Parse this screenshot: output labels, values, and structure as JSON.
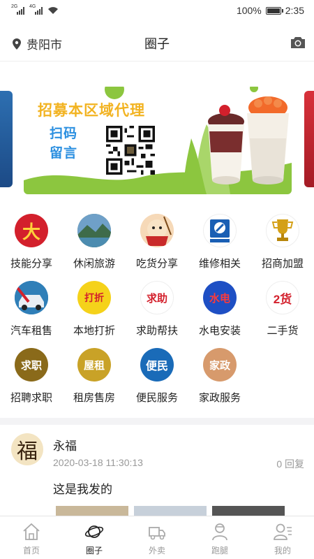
{
  "status_bar": {
    "signal1_tag": "2G",
    "signal2_tag": "4G",
    "battery_text": "100%",
    "battery_level": 1.0,
    "time": "2:35"
  },
  "header": {
    "location": "贵阳市",
    "title": "圈子"
  },
  "banner": {
    "headline": "招募本区域代理",
    "sub_line1": "扫码",
    "sub_line2": "留言"
  },
  "categories": [
    {
      "label": "技能分享",
      "icon_text": "大",
      "icon_bg": "#d3202c",
      "icon_fg": "#ffd23a"
    },
    {
      "label": "休闲旅游",
      "icon_text": "",
      "icon_bg": "#5a8a6a",
      "icon_fg": "#ffffff"
    },
    {
      "label": "吃货分享",
      "icon_text": "",
      "icon_bg": "#f6d9b8",
      "icon_fg": "#333333"
    },
    {
      "label": "维修相关",
      "icon_text": "",
      "icon_bg": "#ffffff",
      "icon_fg": "#1a5fb4"
    },
    {
      "label": "招商加盟",
      "icon_text": "",
      "icon_bg": "#ffffff",
      "icon_fg": "#d4a017"
    },
    {
      "label": "汽车租售",
      "icon_text": "",
      "icon_bg": "#2f7fb8",
      "icon_fg": "#ffffff"
    },
    {
      "label": "本地打折",
      "icon_text": "打折",
      "icon_bg": "#f5d21a",
      "icon_fg": "#d3202c"
    },
    {
      "label": "求助帮扶",
      "icon_text": "求助",
      "icon_bg": "#ffffff",
      "icon_fg": "#d3202c"
    },
    {
      "label": "水电安装",
      "icon_text": "水电",
      "icon_bg": "#1e4fc4",
      "icon_fg": "#ff3a3a"
    },
    {
      "label": "二手货",
      "icon_text": "2货",
      "icon_bg": "#ffffff",
      "icon_fg": "#d3202c"
    },
    {
      "label": "招聘求职",
      "icon_text": "求职",
      "icon_bg": "#8a6a1a",
      "icon_fg": "#ffffff"
    },
    {
      "label": "租房售房",
      "icon_text": "屋租",
      "icon_bg": "#c9a227",
      "icon_fg": "#ffffff"
    },
    {
      "label": "便民服务",
      "icon_text": "便民",
      "icon_bg": "#1a6bb8",
      "icon_fg": "#ffffff"
    },
    {
      "label": "家政服务",
      "icon_text": "家政",
      "icon_bg": "#d79a6c",
      "icon_fg": "#ffffff"
    }
  ],
  "post": {
    "avatar_char": "福",
    "author": "永福",
    "timestamp": "2020-03-18 11:30:13",
    "replies": "0 回复",
    "text": "这是我发的"
  },
  "tabbar": {
    "items": [
      {
        "label": "首页",
        "icon": "home-icon",
        "active": false
      },
      {
        "label": "圈子",
        "icon": "planet-icon",
        "active": true
      },
      {
        "label": "外卖",
        "icon": "delivery-truck-icon",
        "active": false
      },
      {
        "label": "跑腿",
        "icon": "courier-icon",
        "active": false
      },
      {
        "label": "我的",
        "icon": "profile-icon",
        "active": false
      }
    ]
  },
  "colors": {
    "accent_green": "#8cc63f",
    "banner_yellow": "#f2b321",
    "banner_blue": "#2b8fe0"
  }
}
